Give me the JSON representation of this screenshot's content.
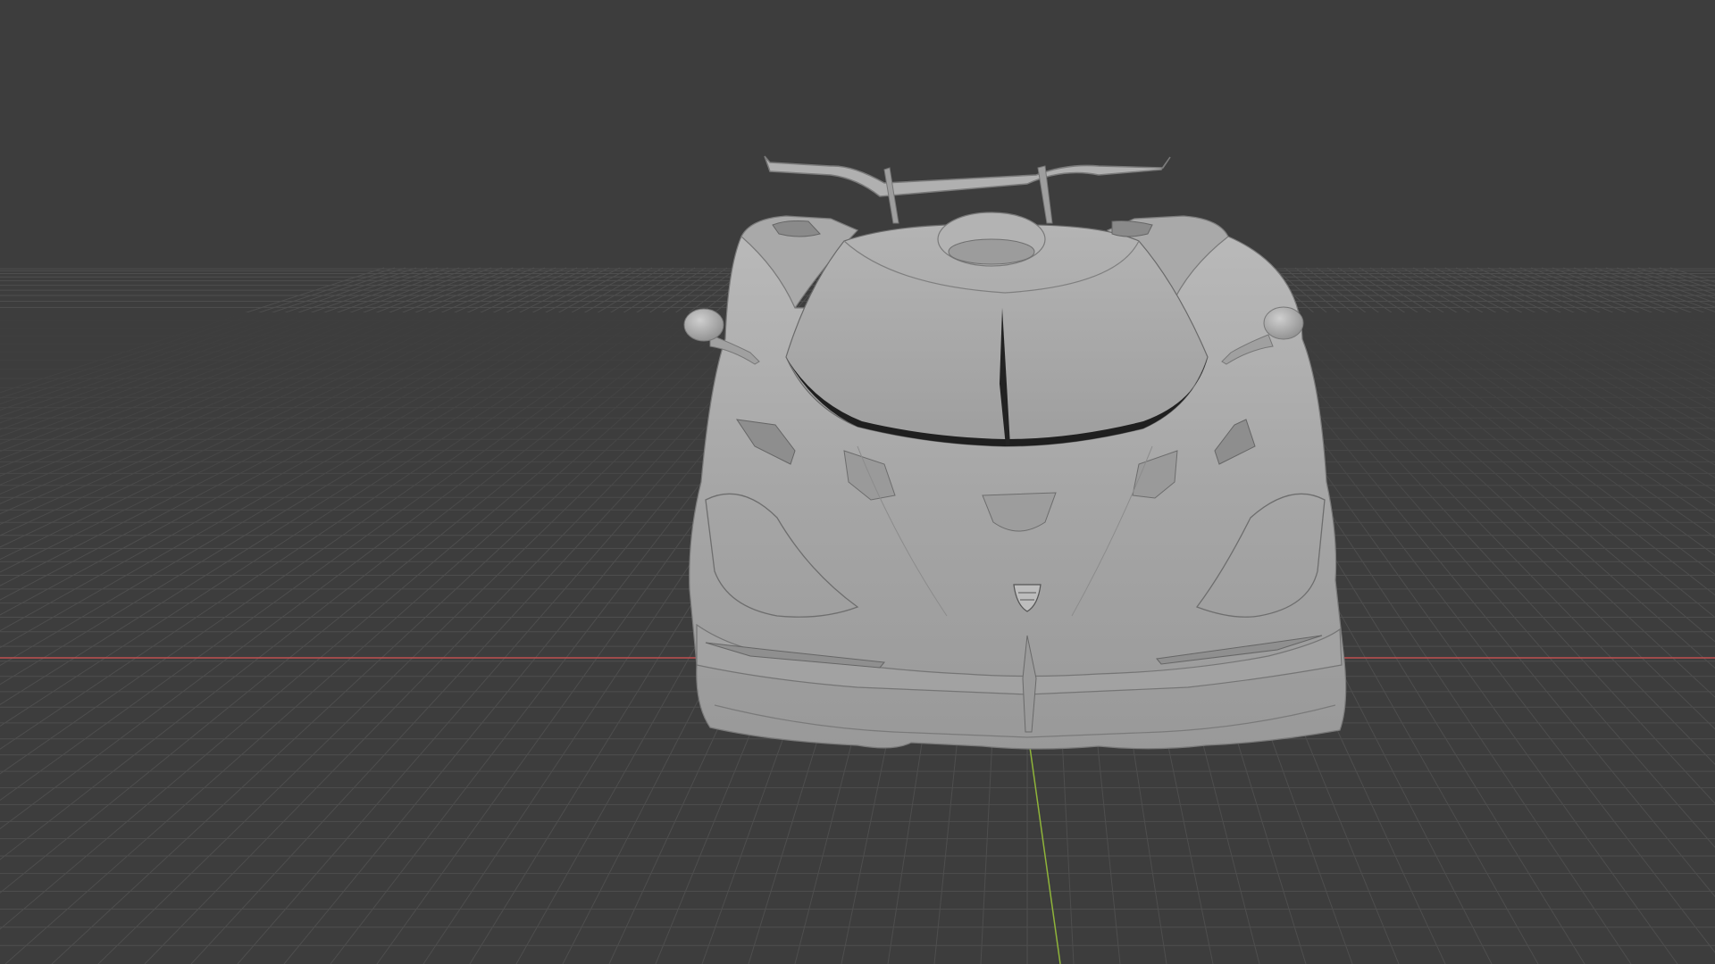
{
  "viewport": {
    "mode": "3D viewport",
    "shading": "solid",
    "object": "car-model",
    "background_color": "#3d3d3d",
    "grid_color": "#4e4e4e",
    "x_axis_color": "#c05050",
    "y_axis_color": "#8fb43a",
    "model_color": "#a8a8a8"
  }
}
